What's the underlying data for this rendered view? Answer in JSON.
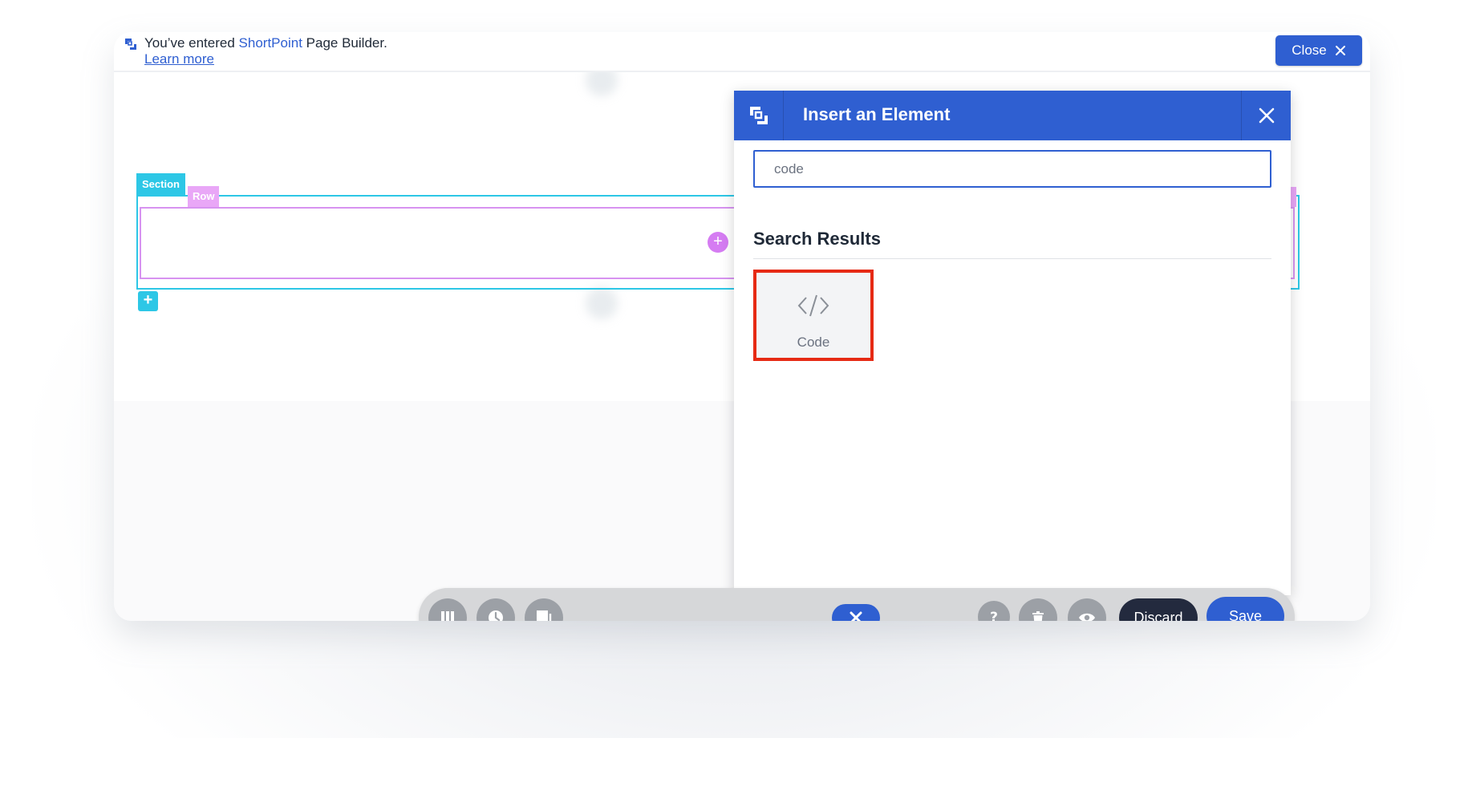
{
  "notice": {
    "prefix": "You’ve entered",
    "brand": "ShortPoint",
    "suffix": "Page Builder.",
    "learn_more": "Learn more",
    "close_label": "Close"
  },
  "canvas": {
    "section_tag": "Section",
    "row_tag": "Row"
  },
  "panel": {
    "title": "Insert an Element",
    "search_value": "code",
    "results_heading": "Search Results",
    "results": [
      {
        "label": "Code",
        "icon": "code-icon",
        "highlighted": true
      }
    ]
  },
  "toolbar": {
    "discard_label": "Discard",
    "save_label": "Save",
    "icons": [
      "columns-icon",
      "history-icon",
      "layers-icon",
      "cancel-icon",
      "help-icon",
      "trash-icon",
      "preview-icon"
    ]
  },
  "colors": {
    "primary": "#2f5fd1",
    "section": "#2dc7e6",
    "row": "#d793f0",
    "highlight": "#e62a14",
    "discard": "#232a3e",
    "toolbar_icon": "#9ca0a6"
  }
}
